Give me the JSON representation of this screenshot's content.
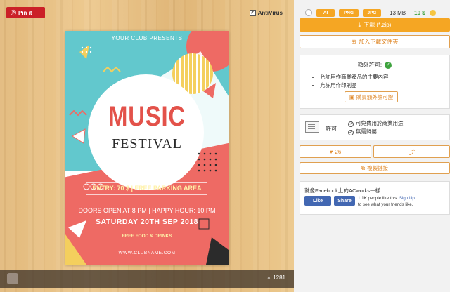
{
  "pin": {
    "label": "Pin it",
    "icon": "pinterest-icon"
  },
  "antivirus": {
    "label": "AntiVirus"
  },
  "poster": {
    "club": "YOUR CLUB PRESENTS",
    "title1": "MUSIC",
    "title2": "FESTIVAL",
    "entry": "ENTRY: 70 $  |  FREE PARKING AREA",
    "doors": "DOORS OPEN AT 8 PM | HAPPY HOUR: 10 PM",
    "date": "SATURDAY 20TH SEP 2018",
    "food": "FREE FOOD & DRINKS",
    "web": "WWW.CLUBNAME.COM"
  },
  "bottombar": {
    "downloads": "1281"
  },
  "formats": {
    "tags": [
      "AI",
      "PNG",
      "JPG"
    ],
    "size": "13 MB",
    "price": "10 $"
  },
  "buttons": {
    "download": "下載 (*.zip)",
    "favorite": "加入下載文件夾",
    "buy_license": "購買額外許可證",
    "like_count": "26",
    "copy_link": "複製鏈接"
  },
  "license": {
    "title": "額外許可:",
    "items": [
      "允許用作商業產品的主要內容",
      "允許用作印刷品"
    ]
  },
  "permit": {
    "label": "許可",
    "items": [
      "可免費用於商業用途",
      "無需歸屬"
    ]
  },
  "facebook": {
    "title": "就像Facebook上的ACworks一樣",
    "like": "Like",
    "share": "Share",
    "line1": "1.1K people like this.",
    "signup": "Sign Up",
    "line2": "to see what your friends like."
  },
  "colors": {
    "accent": "#f5a623",
    "pin": "#cb2027",
    "facebook": "#4267b2",
    "green": "#3ea33e"
  }
}
